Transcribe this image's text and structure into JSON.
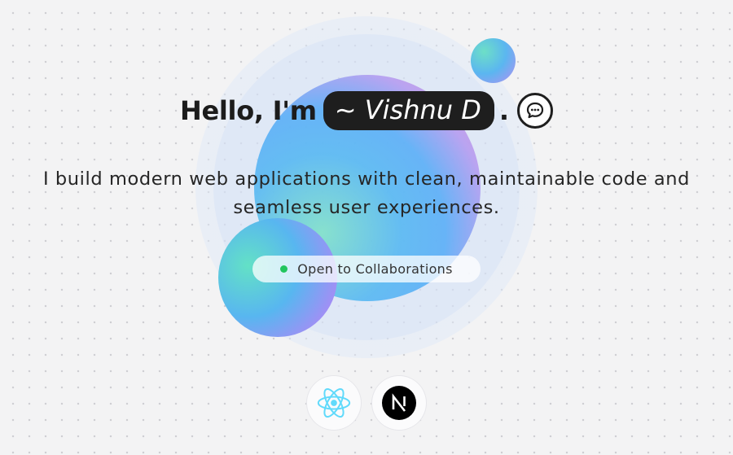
{
  "hero": {
    "greeting": "Hello, I'm",
    "name": "~ Vishnu D",
    "punctuation": ".",
    "tagline_line1": "I build modern web applications with clean, maintainable code and",
    "tagline_line2": "seamless user experiences.",
    "status_text": "Open to Collaborations",
    "status_color": "#22c55e"
  },
  "icons": {
    "chat": "chat-bubble-icon",
    "tech": [
      "react-icon",
      "nextjs-icon"
    ]
  },
  "colors": {
    "accent_dark": "#1e1e1e",
    "react": "#61dafb"
  }
}
